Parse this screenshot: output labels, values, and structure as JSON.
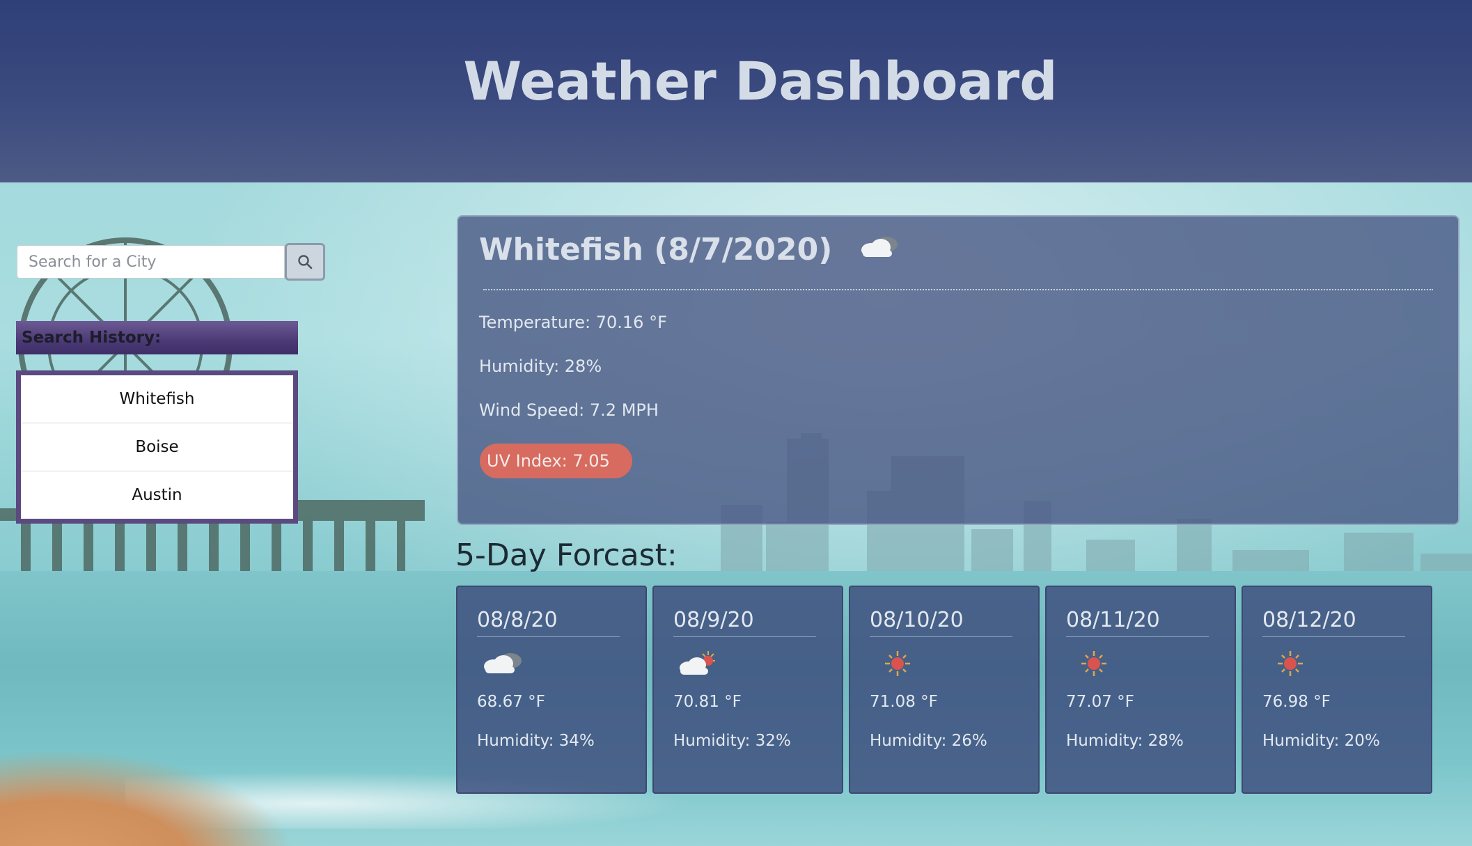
{
  "header": {
    "title": "Weather Dashboard"
  },
  "search": {
    "placeholder": "Search for a City",
    "value": "",
    "button_icon": "search-icon"
  },
  "history": {
    "title": "Search History:",
    "items": [
      "Whitefish",
      "Boise",
      "Austin"
    ]
  },
  "current": {
    "title": "Whitefish (8/7/2020)",
    "icon": "cloudy-icon",
    "temperature": "Temperature: 70.16 °F",
    "humidity": "Humidity: 28%",
    "wind": "Wind Speed: 7.2 MPH",
    "uv": "UV Index: 7.05",
    "uv_color": "#d76b5f"
  },
  "forecast": {
    "title": "5-Day Forcast:",
    "days": [
      {
        "date": "08/8/20",
        "icon": "cloudy-icon",
        "temp": "68.67 °F",
        "humidity": "Humidity: 34%"
      },
      {
        "date": "08/9/20",
        "icon": "partly-sunny-icon",
        "temp": "70.81 °F",
        "humidity": "Humidity: 32%"
      },
      {
        "date": "08/10/20",
        "icon": "sun-icon",
        "temp": "71.08 °F",
        "humidity": "Humidity: 26%"
      },
      {
        "date": "08/11/20",
        "icon": "sun-icon",
        "temp": "77.07 °F",
        "humidity": "Humidity: 28%"
      },
      {
        "date": "08/12/20",
        "icon": "sun-icon",
        "temp": "76.98 °F",
        "humidity": "Humidity: 20%"
      }
    ]
  },
  "colors": {
    "header_bg": "#3b4b7f",
    "history_header": "#4b3a75",
    "card_bg": "#46558 2"
  }
}
